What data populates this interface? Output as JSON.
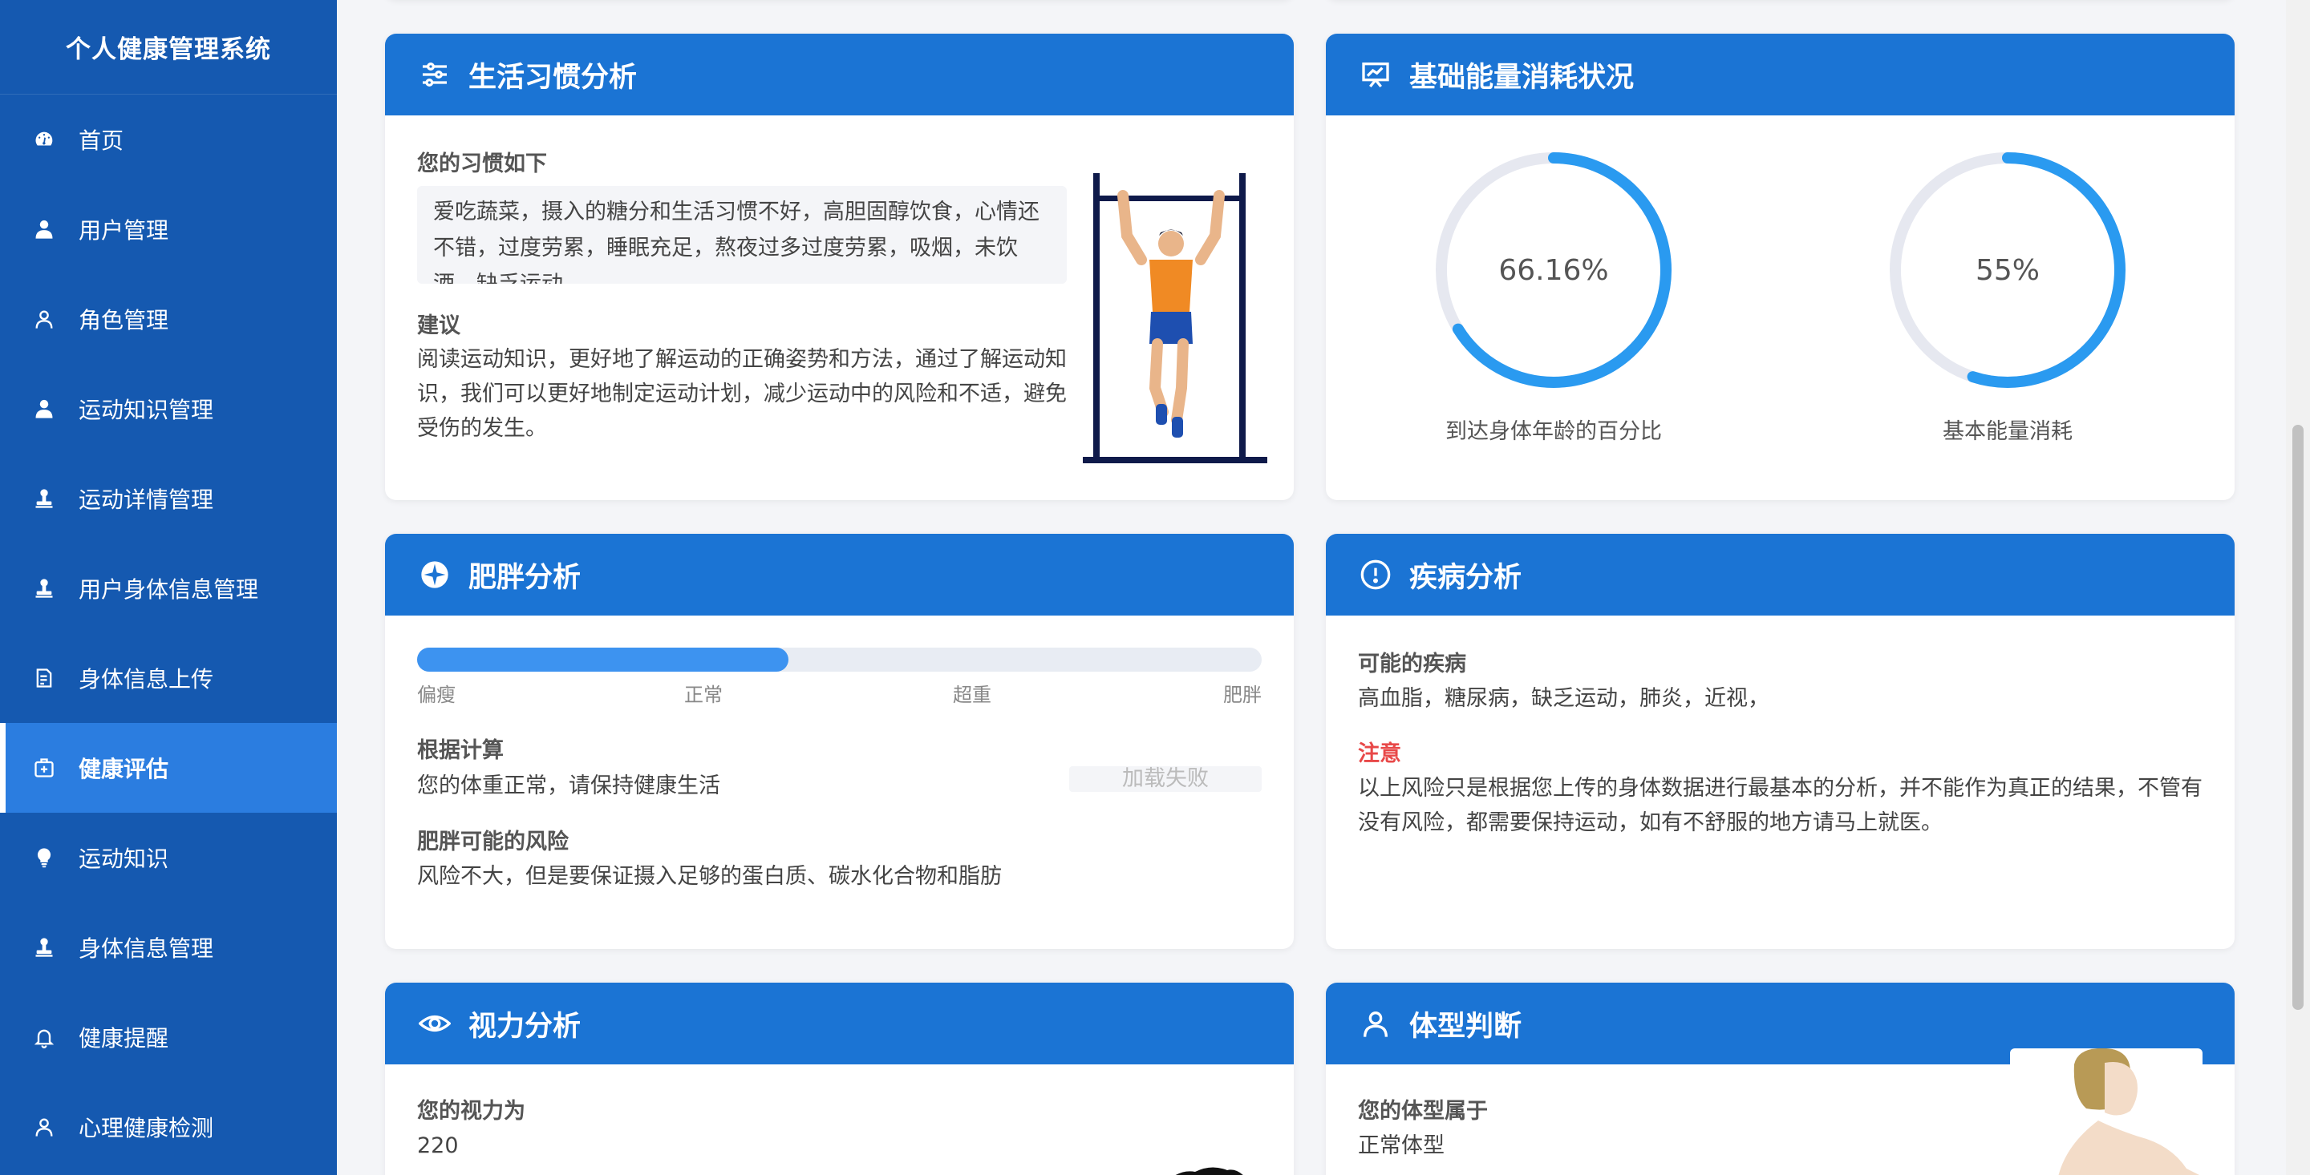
{
  "app": {
    "title": "个人健康管理系统"
  },
  "sidebar": {
    "items": [
      {
        "label": "首页",
        "icon": "dashboard-icon"
      },
      {
        "label": "用户管理",
        "icon": "user-icon"
      },
      {
        "label": "角色管理",
        "icon": "user-outline-icon"
      },
      {
        "label": "运动知识管理",
        "icon": "user-icon"
      },
      {
        "label": "运动详情管理",
        "icon": "stamp-icon"
      },
      {
        "label": "用户身体信息管理",
        "icon": "stamp-icon"
      },
      {
        "label": "身体信息上传",
        "icon": "document-icon"
      },
      {
        "label": "健康评估",
        "icon": "medical-box-icon"
      },
      {
        "label": "运动知识",
        "icon": "lightbulb-icon"
      },
      {
        "label": "身体信息管理",
        "icon": "stamp-icon"
      },
      {
        "label": "健康提醒",
        "icon": "bell-icon"
      },
      {
        "label": "心理健康检测",
        "icon": "user-outline-icon"
      }
    ],
    "active_index": 7
  },
  "habits": {
    "title": "生活习惯分析",
    "habit_label": "您的习惯如下",
    "habit_text": "爱吃蔬菜，摄入的糖分和生活习惯不好，高胆固醇饮食，心情还不错，过度劳累，睡眠充足，熬夜过多过度劳累，吸烟，未饮酒，缺乏运动，",
    "advice_label": "建议",
    "advice_text": "阅读运动知识，更好地了解运动的正确姿势和方法，通过了解运动知识，我们可以更好地制定运动计划，减少运动中的风险和不适，避免受伤的发生。"
  },
  "energy": {
    "title": "基础能量消耗状况",
    "rings": [
      {
        "value_text": "66.16%",
        "fraction": 0.6616,
        "label": "到达身体年龄的百分比"
      },
      {
        "value_text": "55%",
        "fraction": 0.55,
        "label": "基本能量消耗"
      }
    ],
    "ring_color": "#2a9af0",
    "track_color": "#e6e8f0"
  },
  "obesity": {
    "title": "肥胖分析",
    "progress_fraction": 0.44,
    "ticks": [
      "偏瘦",
      "正常",
      "超重",
      "肥胖"
    ],
    "calc_label": "根据计算",
    "calc_text": "您的体重正常，请保持健康生活",
    "image_fail_text": "加载失败",
    "risk_label": "肥胖可能的风险",
    "risk_text": "风险不大，但是要保证摄入足够的蛋白质、碳水化合物和脂肪"
  },
  "disease": {
    "title": "疾病分析",
    "possible_label": "可能的疾病",
    "possible_text": "高血脂，糖尿病，缺乏运动，肺炎，近视，",
    "note_label": "注意",
    "note_text": "以上风险只是根据您上传的身体数据进行最基本的分析，并不能作为真正的结果，不管有没有风险，都需要保持运动，如有不舒服的地方请马上就医。"
  },
  "vision": {
    "title": "视力分析",
    "label": "您的视力为",
    "value": "220"
  },
  "bodytype": {
    "title": "体型判断",
    "label": "您的体型属于",
    "value": "正常体型"
  },
  "colors": {
    "sidebar": "#1559b0",
    "active": "#2b7de0",
    "header": "#1b74d4",
    "warning": "#e84848"
  }
}
